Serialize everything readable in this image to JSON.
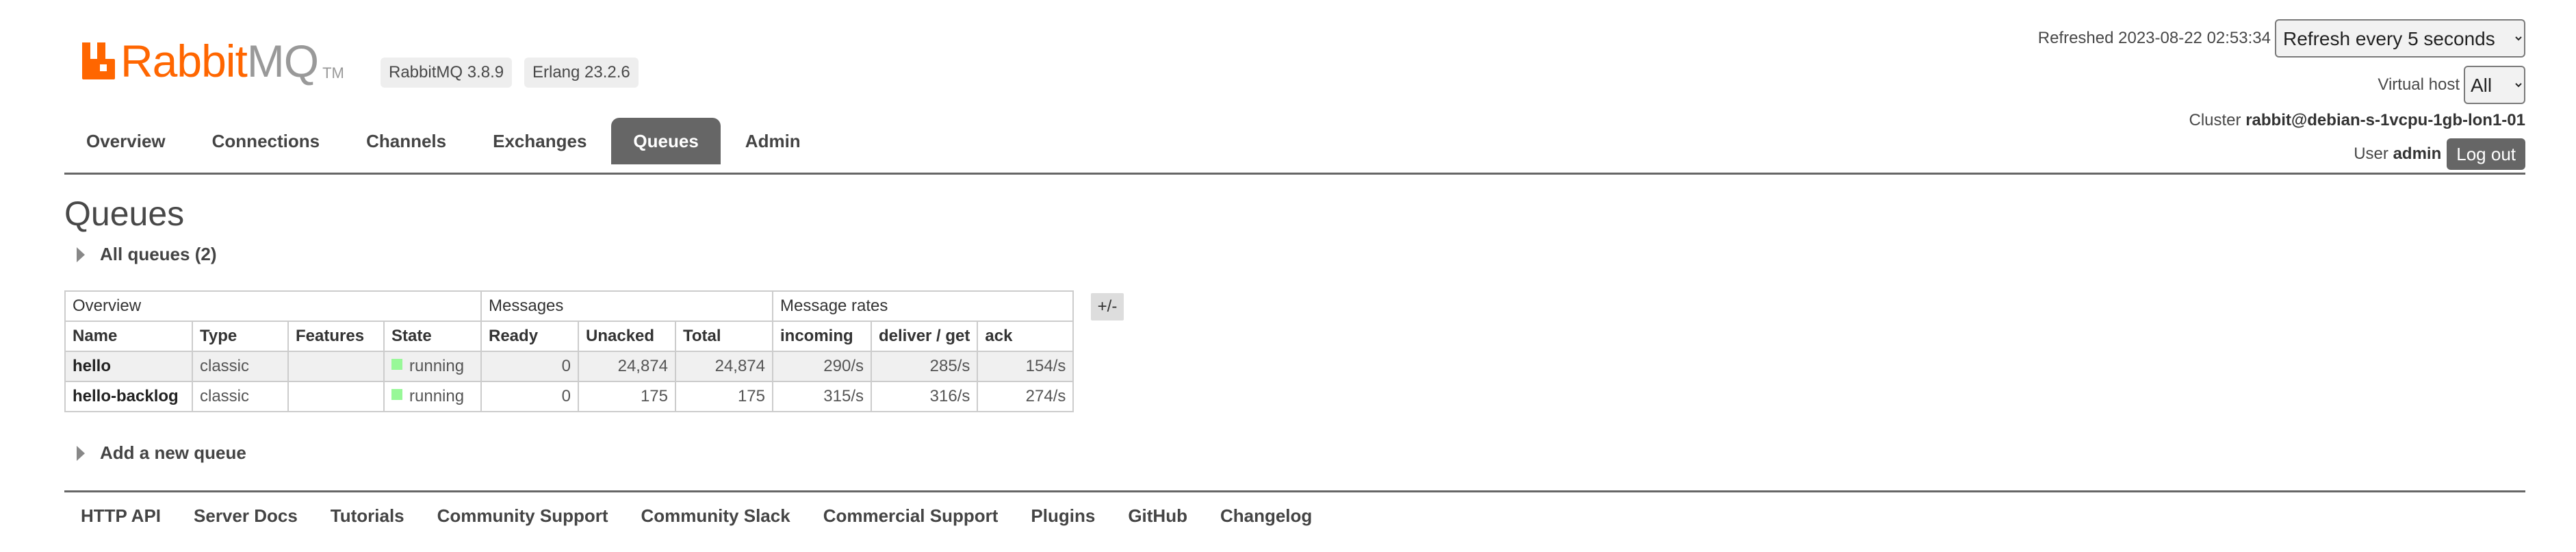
{
  "brand": {
    "name_part1": "Rabbit",
    "name_part2": "MQ",
    "trademark": "TM",
    "rabbitmq_version": "RabbitMQ 3.8.9",
    "erlang_version": "Erlang 23.2.6",
    "brand_color": "#ff6600"
  },
  "status": {
    "refreshed_label": "Refreshed 2023-08-22 02:53:34",
    "refresh_option": "Refresh every 5 seconds",
    "vhost_label": "Virtual host",
    "vhost_value": "All",
    "cluster_label": "Cluster",
    "cluster_name": "rabbit@debian-s-1vcpu-1gb-lon1-01",
    "user_label": "User",
    "user_name": "admin",
    "logout_label": "Log out"
  },
  "nav": {
    "tabs": [
      {
        "label": "Overview",
        "selected": false
      },
      {
        "label": "Connections",
        "selected": false
      },
      {
        "label": "Channels",
        "selected": false
      },
      {
        "label": "Exchanges",
        "selected": false
      },
      {
        "label": "Queues",
        "selected": true
      },
      {
        "label": "Admin",
        "selected": false
      }
    ],
    "tab_active_color": "#666666"
  },
  "main": {
    "title": "Queues",
    "all_queues_toggle": "All queues (2)",
    "add_queue_toggle": "Add a new queue",
    "column_toggle": "+/-",
    "table": {
      "groups": {
        "overview": "Overview",
        "messages": "Messages",
        "rates": "Message rates"
      },
      "headers": {
        "name": "Name",
        "type": "Type",
        "features": "Features",
        "state": "State",
        "ready": "Ready",
        "unacked": "Unacked",
        "total": "Total",
        "incoming": "incoming",
        "deliver_get": "deliver / get",
        "ack": "ack"
      },
      "rows": [
        {
          "name": "hello",
          "type": "classic",
          "features": "",
          "state": "running",
          "ready": "0",
          "unacked": "24,874",
          "total": "24,874",
          "incoming": "290/s",
          "deliver_get": "285/s",
          "ack": "154/s"
        },
        {
          "name": "hello-backlog",
          "type": "classic",
          "features": "",
          "state": "running",
          "ready": "0",
          "unacked": "175",
          "total": "175",
          "incoming": "315/s",
          "deliver_get": "316/s",
          "ack": "274/s"
        }
      ],
      "state_color": "#98f898"
    }
  },
  "footer": {
    "links": [
      "HTTP API",
      "Server Docs",
      "Tutorials",
      "Community Support",
      "Community Slack",
      "Commercial Support",
      "Plugins",
      "GitHub",
      "Changelog"
    ]
  }
}
